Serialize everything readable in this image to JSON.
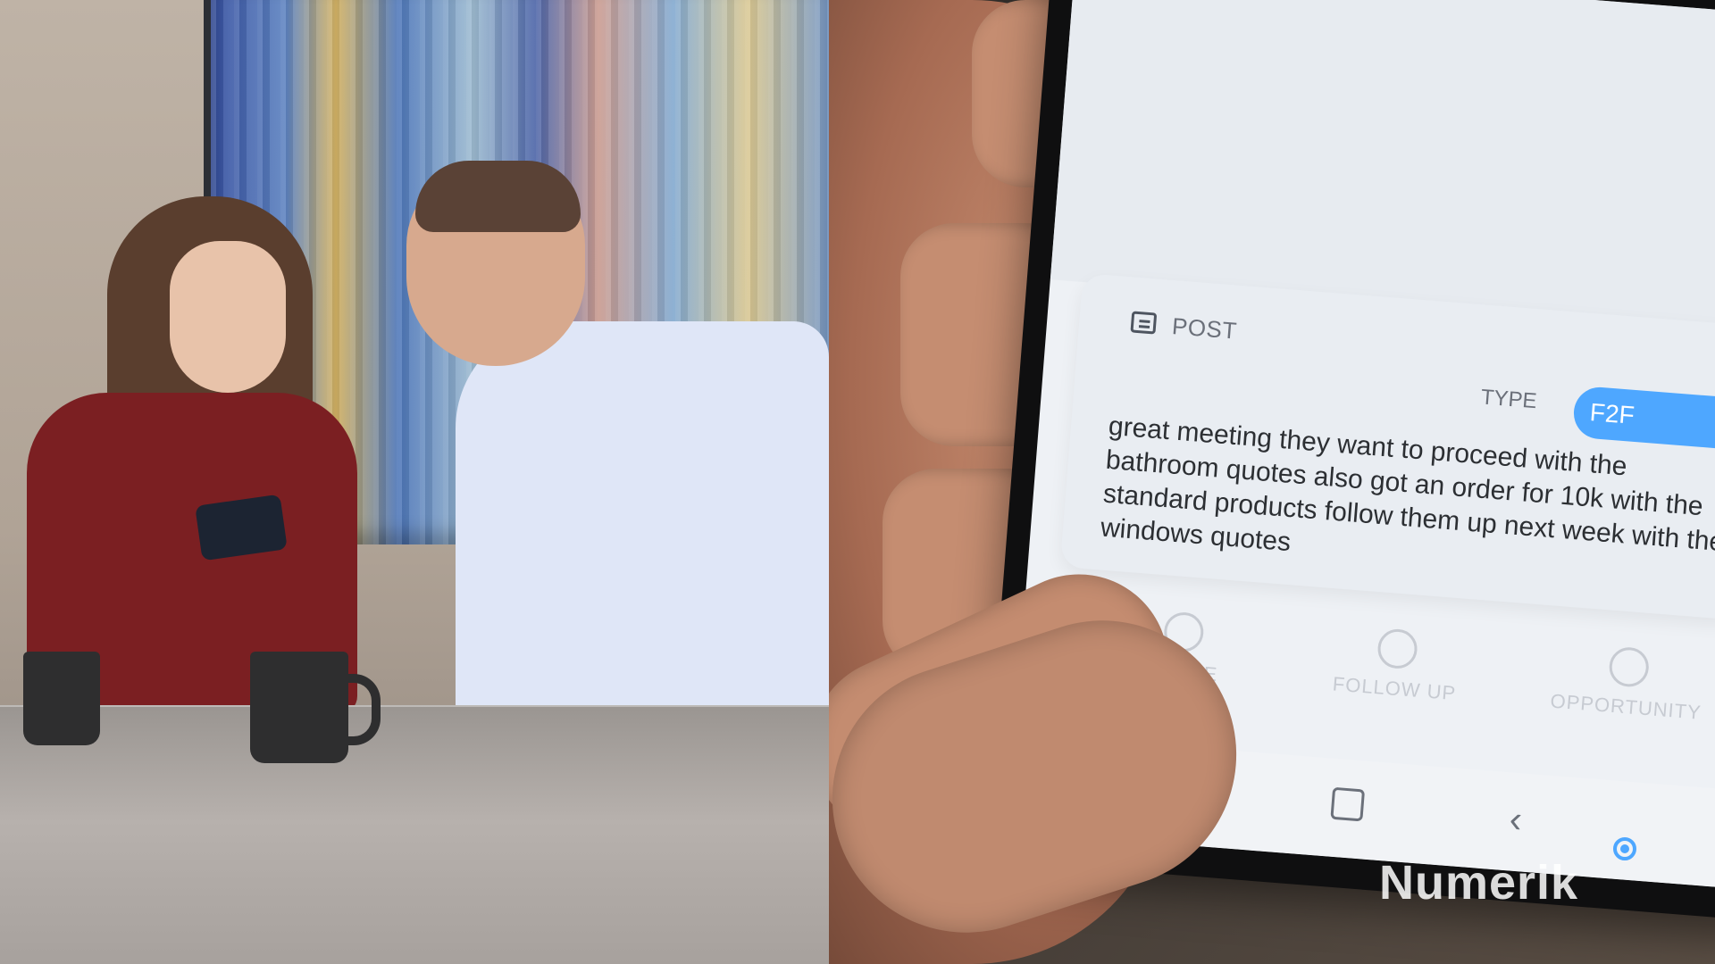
{
  "phone_ui": {
    "post_label": "POST",
    "type_label": "TYPE",
    "type_value": "F2F",
    "post_text": "great meeting they want to proceed with the bathroom quotes also got an order for 10k with the standard products follow them up next week with the windows quotes",
    "actions": [
      {
        "label": "QUOTE",
        "icon": "quote-icon"
      },
      {
        "label": "FOLLOW UP",
        "icon": "follow-up-icon"
      },
      {
        "label": "OPPORTUNITY",
        "icon": "opportunity-icon"
      }
    ],
    "nav": {
      "home_icon": "home-icon",
      "back_icon": "back-icon"
    }
  },
  "brand": {
    "name": "Numerik"
  },
  "colors": {
    "accent": "#4ea7ff",
    "shirt_red": "#7b1f22",
    "shirt_blue": "#dfe6f7"
  }
}
